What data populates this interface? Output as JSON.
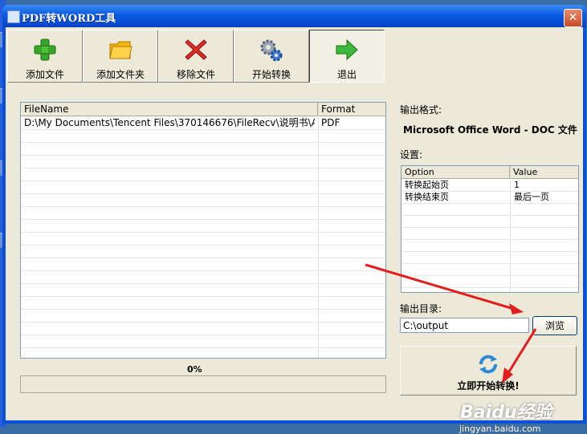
{
  "window": {
    "title": "PDF转WORD工具",
    "close_glyph": "✕"
  },
  "toolbar": [
    {
      "label": "添加文件",
      "icon": "plus-icon"
    },
    {
      "label": "添加文件夹",
      "icon": "folder-icon"
    },
    {
      "label": "移除文件",
      "icon": "red-x-icon"
    },
    {
      "label": "开始转换",
      "icon": "gears-icon"
    },
    {
      "label": "退出",
      "icon": "green-arrow-right-icon"
    }
  ],
  "file_list": {
    "columns": [
      "FileName",
      "Format"
    ],
    "rows": [
      {
        "filename": "D:\\My Documents\\Tencent Files\\370146676\\FileRecv\\说明书\\A...",
        "format": "PDF"
      }
    ]
  },
  "progress": {
    "text": "0%",
    "value": 0
  },
  "output_format": {
    "label": "输出格式:",
    "value": "Microsoft Office Word - DOC 文件"
  },
  "settings": {
    "label": "设置:",
    "columns": [
      "Option",
      "Value"
    ],
    "rows": [
      {
        "option": "转换起始页",
        "value": "1"
      },
      {
        "option": "转换结束页",
        "value": "最后一页"
      }
    ]
  },
  "output_dir": {
    "label": "输出目录:",
    "value": "C:\\output",
    "browse_label": "浏览"
  },
  "convert": {
    "label": "立即开始转换!"
  },
  "watermark": {
    "text": "Baidu经验",
    "sub": "jingyan.baidu.com"
  },
  "colors": {
    "title_bar": "#0a5ae0",
    "dialog_bg": "#ece9d8",
    "annotation_arrow": "#e51c1c"
  }
}
